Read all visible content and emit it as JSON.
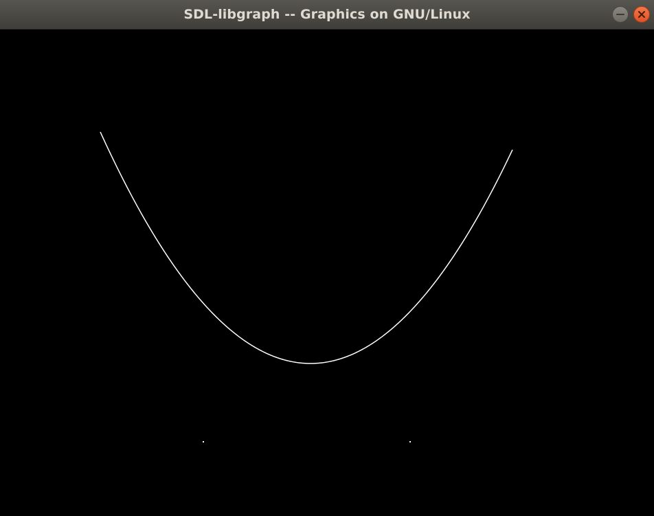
{
  "window": {
    "title": "SDL-libgraph -- Graphics on GNU/Linux",
    "controls": {
      "minimize_icon": "minimize-icon",
      "close_icon": "close-icon",
      "close_color": "#e95420"
    }
  },
  "canvas": {
    "background": "#000000",
    "stroke_color": "#ffffff",
    "content": "parabolic curve drawing with two isolated pixels"
  }
}
